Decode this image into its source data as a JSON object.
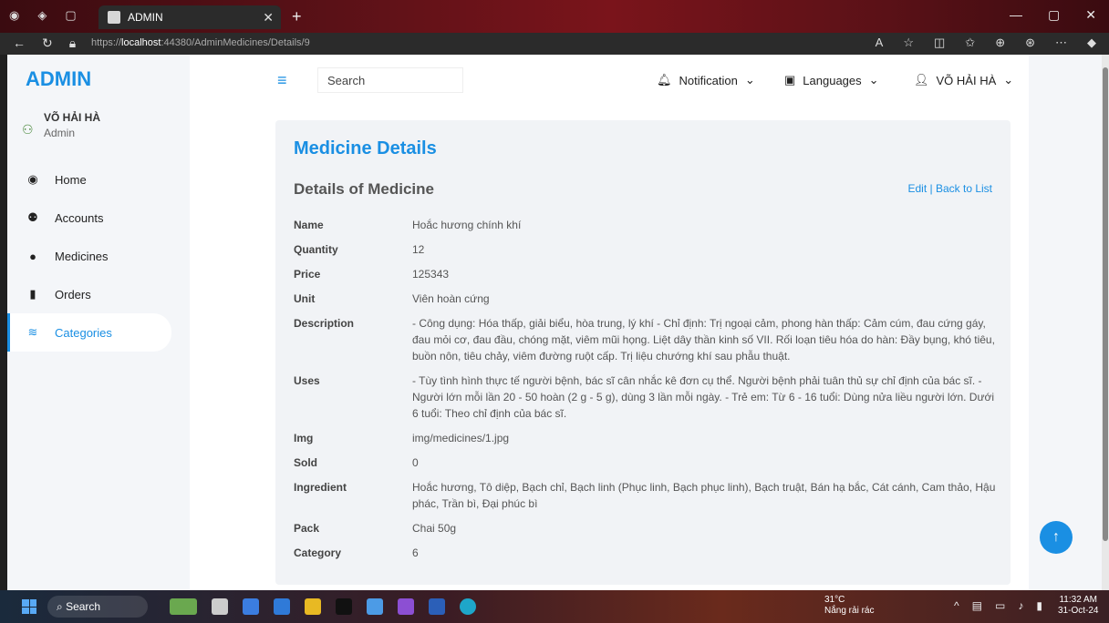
{
  "browser": {
    "tab_title": "ADMIN",
    "url_prefix": "https://",
    "url_host": "localhost",
    "url_rest": ":44380/AdminMedicines/Details/9"
  },
  "sidebar": {
    "brand": "ADMIN",
    "user_name": "VÕ HẢI HÀ",
    "user_role": "Admin",
    "items": [
      {
        "label": "Home",
        "icon": "dashboard-icon"
      },
      {
        "label": "Accounts",
        "icon": "users-icon"
      },
      {
        "label": "Medicines",
        "icon": "pills-icon"
      },
      {
        "label": "Orders",
        "icon": "receipt-icon"
      },
      {
        "label": "Categories",
        "icon": "layers-icon",
        "active": true
      }
    ]
  },
  "topbar": {
    "search_placeholder": "Search",
    "notification": "Notification",
    "languages": "Languages",
    "user": "VÕ HẢI HÀ"
  },
  "content": {
    "title": "Medicine Details",
    "subtitle": "Details of Medicine",
    "edit_link": "Edit",
    "separator": "|",
    "back_link": "Back to List",
    "fields": [
      {
        "key": "Name",
        "value": "Hoắc hương chính khí"
      },
      {
        "key": "Quantity",
        "value": "12"
      },
      {
        "key": "Price",
        "value": "125343"
      },
      {
        "key": "Unit",
        "value": "Viên hoàn cứng"
      },
      {
        "key": "Description",
        "value": "- Công dụng: Hóa thấp, giải biểu, hòa trung, lý khí - Chỉ định: Trị ngoại cảm, phong hàn thấp: Cảm cúm, đau cứng gáy, đau mỏi cơ, đau đầu, chóng mặt, viêm mũi họng. Liệt dây thần kinh số VII. Rối loạn tiêu hóa do hàn: Đầy bụng, khó tiêu, buồn nôn, tiêu chảy, viêm đường ruột cấp. Trị liệu chướng khí sau phẫu thuật."
      },
      {
        "key": "Uses",
        "value": "- Tùy tình hình thực tế người bệnh, bác sĩ cân nhắc kê đơn cụ thể. Người bệnh phải tuân thủ sự chỉ định của bác sĩ. - Người lớn mỗi lần 20 - 50 hoàn (2 g - 5 g), dùng 3 lần mỗi ngày. - Trẻ em: Từ 6 - 16 tuổi: Dùng nửa liều người lớn. Dưới 6 tuổi: Theo chỉ định của bác sĩ."
      },
      {
        "key": "Img",
        "value": "img/medicines/1.jpg"
      },
      {
        "key": "Sold",
        "value": "0"
      },
      {
        "key": "Ingredient",
        "value": "Hoắc hương, Tô diệp, Bạch chỉ, Bạch linh (Phục linh, Bạch phục linh), Bạch truật, Bán hạ bắc, Cát cánh, Cam thảo, Hậu phác, Trần bì, Đại phúc bì"
      },
      {
        "key": "Pack",
        "value": "Chai 50g"
      },
      {
        "key": "Category",
        "value": "6"
      }
    ]
  },
  "taskbar": {
    "search": "Search",
    "temperature": "31°C",
    "weather": "Nắng rải rác",
    "time": "11:32 AM",
    "date": "31-Oct-24"
  },
  "colors": {
    "accent": "#1a8fe3"
  }
}
